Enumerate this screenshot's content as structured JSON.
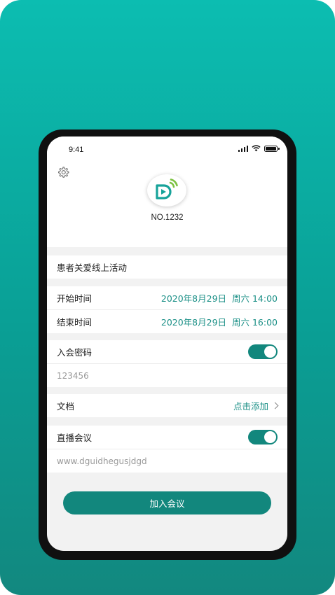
{
  "status_bar": {
    "time": "9:41"
  },
  "header": {
    "meeting_number": "NO.1232"
  },
  "meeting": {
    "title": "患者关爱线上活动",
    "start_label": "开始时间",
    "start_value": "2020年8月29日  周六 14:00",
    "end_label": "结束时间",
    "end_value": "2020年8月29日  周六 16:00",
    "password_label": "入会密码",
    "password_enabled": true,
    "password_value": "123456",
    "docs_label": "文档",
    "docs_action": "点击添加",
    "live_label": "直播会议",
    "live_enabled": true,
    "live_url": "www.dguidhegusjdgd"
  },
  "actions": {
    "join_label": "加入会议"
  },
  "colors": {
    "accent": "#12877d",
    "accent_text": "#1a8f86",
    "background_gradient_top": "#0cbdb1",
    "background_gradient_bottom": "#12887f"
  },
  "icons": {
    "settings": "gear-icon",
    "logo": "app-logo",
    "signal": "cellular-signal-icon",
    "wifi": "wifi-icon",
    "battery": "battery-icon",
    "chevron": "chevron-right-icon"
  }
}
